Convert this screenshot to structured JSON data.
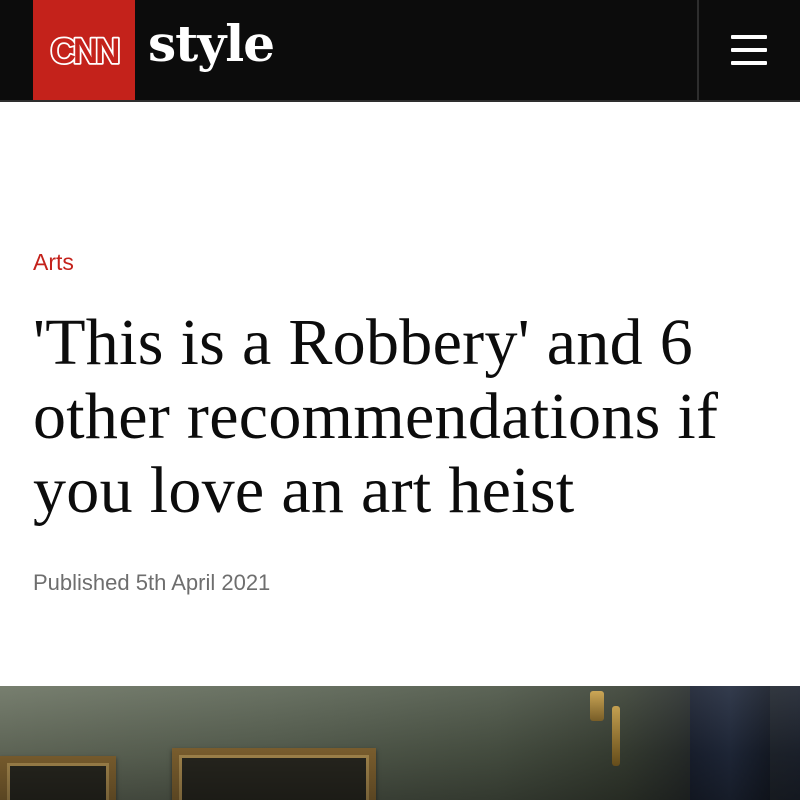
{
  "header": {
    "logo_text": "CNN",
    "section": "style",
    "menu_icon": "hamburger-menu-icon",
    "logo_color": "#c4221b",
    "background_color": "#0c0c0c"
  },
  "article": {
    "category": "Arts",
    "title": "'This is a Robbery' and 6 other recommendations if you love an art heist",
    "published": "Published 5th April 2021"
  },
  "colors": {
    "accent": "#c4221b",
    "headline": "#0c0c0c",
    "meta": "#6e6e6e"
  }
}
